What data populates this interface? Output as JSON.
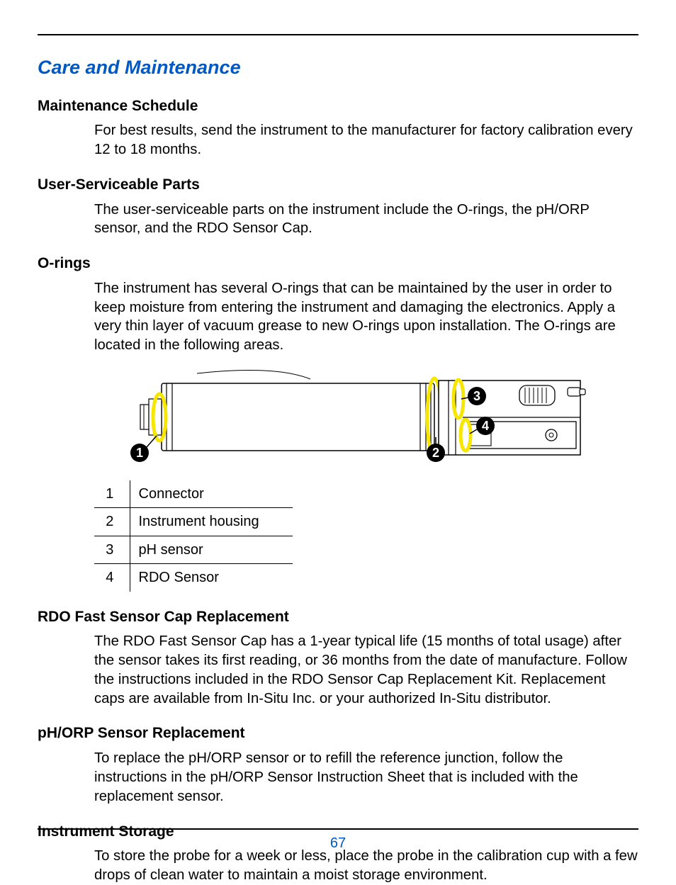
{
  "page_number": "67",
  "h1": "Care and Maintenance",
  "sections": {
    "maintSchedule": {
      "title": "Maintenance Schedule",
      "body": "For best results, send the instrument to the manufacturer for factory calibration every 12 to 18 months."
    },
    "userServiceable": {
      "title": "User-Serviceable Parts",
      "body": "The user-serviceable parts on the instrument include the O-rings, the pH/ORP sensor, and the RDO Sensor Cap."
    },
    "orings": {
      "title": "O-rings",
      "body": "The instrument has several O-rings that can be maintained by the user in order to keep moisture from entering the instrument and damaging the electronics. Apply a very thin layer of vacuum grease to new O-rings upon installation. The O-rings are located in the following areas."
    },
    "rdoCap": {
      "title": "RDO Fast Sensor Cap Replacement",
      "body": "The RDO Fast Sensor Cap has a 1-year typical life (15 months of total usage) after the sensor takes its first reading, or 36 months from the date of manufacture. Follow the instructions included in the RDO Sensor Cap Replacement Kit. Replacement caps are available from In-Situ Inc. or your authorized In-Situ distributor."
    },
    "phorp": {
      "title": "pH/ORP Sensor Replacement",
      "body": "To replace the pH/ORP sensor or to refill the reference junction, follow the instructions in the pH/ORP Sensor Instruction Sheet that is included with the replacement sensor."
    },
    "storage": {
      "title": "Instrument Storage",
      "body": "To store the probe for a week or less, place the probe in the calibration cup with a few drops of clean water to maintain a moist storage environment."
    }
  },
  "legend": {
    "r1": {
      "n": "1",
      "label": "Connector"
    },
    "r2": {
      "n": "2",
      "label": "Instrument housing"
    },
    "r3": {
      "n": "3",
      "label": "pH sensor"
    },
    "r4": {
      "n": "4",
      "label": "RDO Sensor"
    }
  },
  "callouts": {
    "c1": "1",
    "c2": "2",
    "c3": "3",
    "c4": "4"
  }
}
